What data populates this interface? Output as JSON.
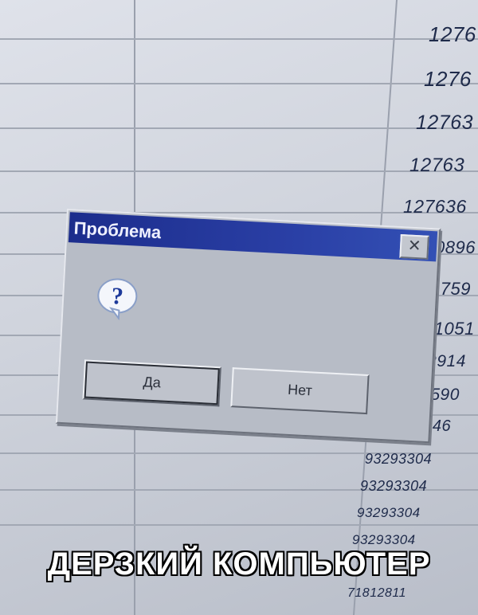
{
  "spreadsheet": {
    "right_column_numbers": [
      "1276",
      "1276",
      "12763",
      "12763",
      "127636",
      "0896",
      "1759",
      "21051",
      "32914",
      "14590",
      "35346",
      "93293304",
      "93293304",
      "93293304",
      "93293304",
      "71812811"
    ]
  },
  "dialog": {
    "title": "Проблема",
    "close_glyph": "✕",
    "icon": "question-icon",
    "buttons": {
      "yes": "Да",
      "no": "Нет"
    }
  },
  "caption": "ДЕРЗКИЙ КОМПЬЮТЕР",
  "colors": {
    "titlebar": "#1c2d8c",
    "dialog_bg": "#b7bcc6",
    "caption_text": "#ffffff"
  }
}
